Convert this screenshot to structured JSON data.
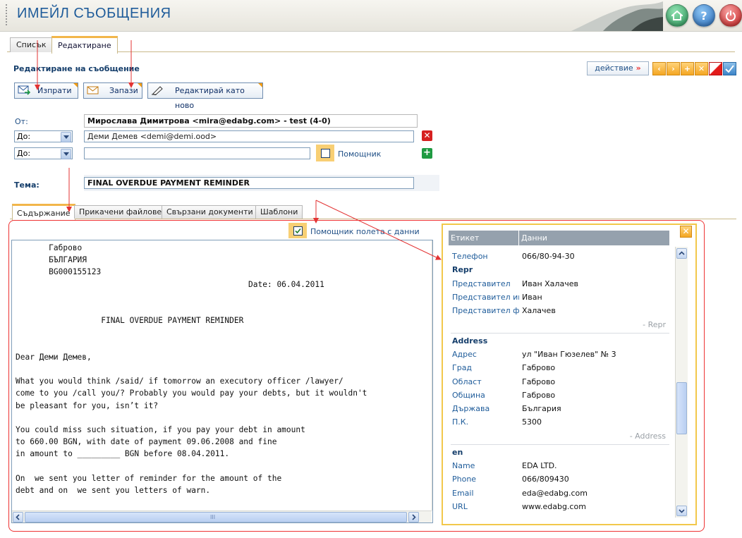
{
  "app": {
    "title": "ИМЕЙЛ СЪОБЩЕНИЯ"
  },
  "header": {
    "home_icon": "home-icon",
    "help_icon": "help-icon",
    "help_glyph": "?",
    "power_icon": "power-icon"
  },
  "tabs": [
    {
      "label": "Списък"
    },
    {
      "label": "Редактиране"
    }
  ],
  "section_title": "Редактиране на съобщение",
  "action": {
    "label": "действие",
    "arrow": "»"
  },
  "nav_buttons": {
    "first": "‹",
    "next": "›",
    "add": "+",
    "close": "✕"
  },
  "toolbar": {
    "send_label": "Изпрати",
    "save_label": "Запази",
    "save_as_new_label": "Редактирай като ново"
  },
  "form": {
    "from_label": "От:",
    "from_value": "Мирослава Димитрова <mira@edabg.com> - test (4-0)",
    "to_select_1": "До:",
    "to_value_1": "Деми Демев <demi@demi.ood>",
    "to_select_2": "До:",
    "to_value_2": "",
    "assistant_label": "Помощник",
    "remove_glyph": "✕",
    "add_glyph": "+",
    "subject_label": "Тема:",
    "subject_value": "FINAL OVERDUE PAYMENT REMINDER"
  },
  "subtabs": [
    {
      "label": "Съдържание"
    },
    {
      "label": "Прикачени файлове"
    },
    {
      "label": "Свързани документи"
    },
    {
      "label": "Шаблони"
    }
  ],
  "helper": {
    "label": "Помощник полета с данни",
    "checked": true
  },
  "editor": {
    "body": "       Габрово\n       БЪЛГАРИЯ\n       BG000155123\n                                                 Date: 06.04.2011\n\n\n                  FINAL OVERDUE PAYMENT REMINDER\n\n\nDear Деми Демев,\n\nWhat you would think /said/ if tomorrow an executory officer /lawyer/\ncome to you /call you/? Probably you would pay your debts, but it wouldn't\nbe pleasant for you, isn’t it?\n\nYou could miss such situation, if you pay your debt in amount\nto 660.00 BGN, with date of payment 09.06.2008 and fine\nin amount to _________ BGN before 08.04.2011.\n\nOn  we sent you letter of reminder for the amount of the\ndebt and on  we sent you letters of warn.",
    "hscroll_grip": "III",
    "vscroll_grip": "≡"
  },
  "data_panel": {
    "col_label": "Етикет",
    "col_data": "Данни",
    "close_glyph": "✕",
    "top_rows": [
      {
        "label": "Телефон",
        "value": "066/80-94-30"
      }
    ],
    "groups": [
      {
        "name": "Repr",
        "footer": "- Repr",
        "rows": [
          {
            "label": "Представител",
            "value": "Иван Халачев"
          },
          {
            "label": "Представител име",
            "value": "Иван"
          },
          {
            "label": "Представител фам",
            "value": "Халачев"
          }
        ]
      },
      {
        "name": "Address",
        "footer": "- Address",
        "rows": [
          {
            "label": "Адрес",
            "value": "ул \"Иван Гюзелев\" № 3"
          },
          {
            "label": "Град",
            "value": "Габрово"
          },
          {
            "label": "Област",
            "value": "Габрово"
          },
          {
            "label": "Община",
            "value": "Габрово"
          },
          {
            "label": "Държава",
            "value": "България"
          },
          {
            "label": "П.К.",
            "value": "5300"
          }
        ]
      },
      {
        "name": "en",
        "footer": "",
        "rows": [
          {
            "label": "Name",
            "value": "EDA LTD."
          },
          {
            "label": "Phone",
            "value": "066/809430"
          },
          {
            "label": "Email",
            "value": "eda@edabg.com"
          },
          {
            "label": "URL",
            "value": "www.edabg.com"
          }
        ]
      }
    ]
  },
  "colors": {
    "accent": "#1f5c9a",
    "orange": "#f4a623",
    "annotation_red": "#e33333",
    "panel_border": "#f2c84b"
  }
}
